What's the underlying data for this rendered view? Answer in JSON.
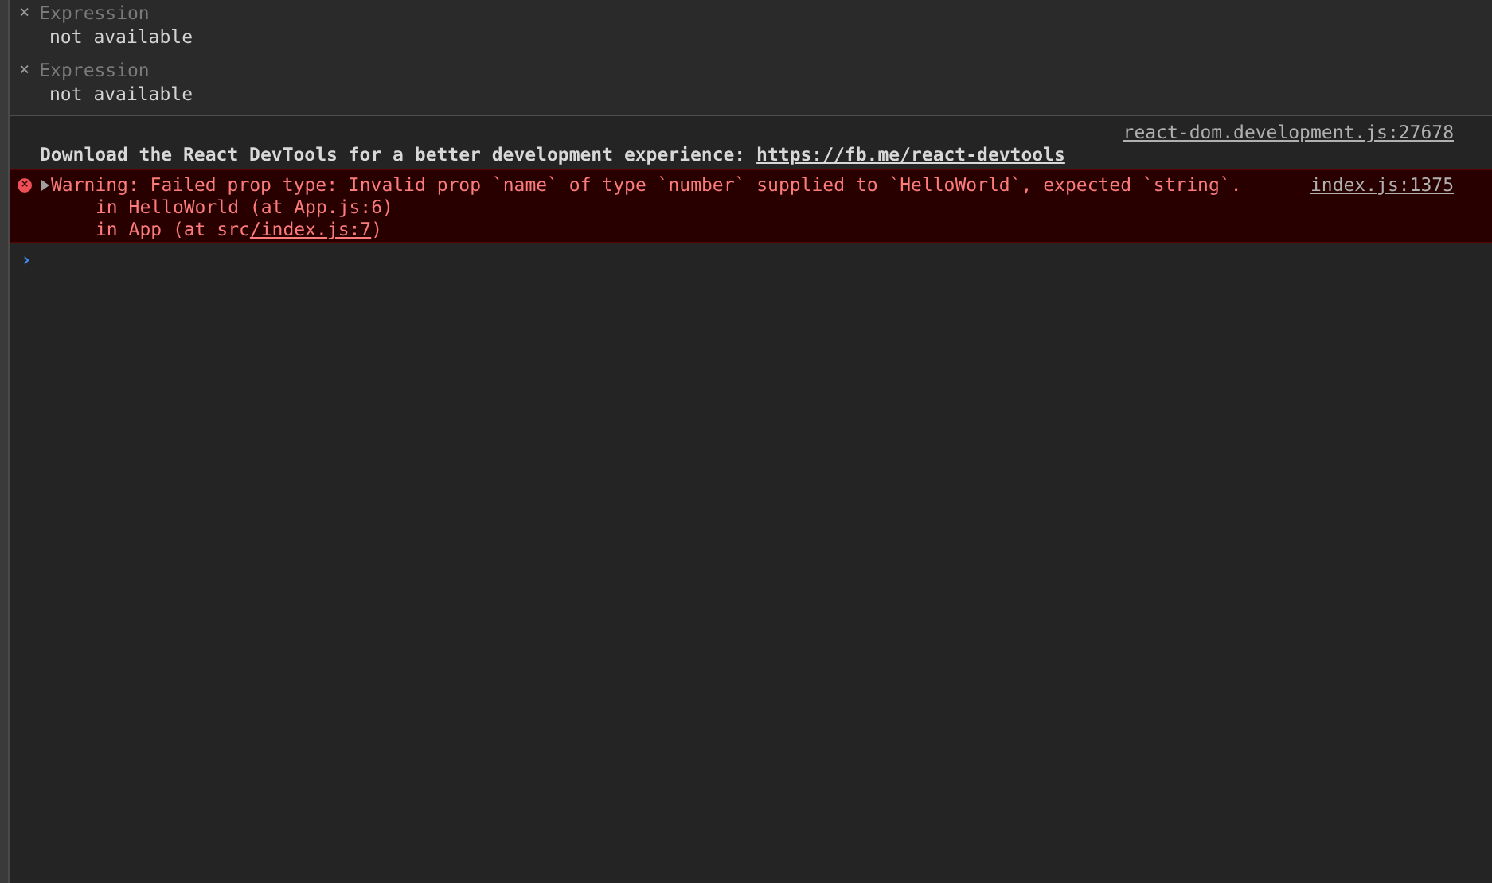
{
  "watch_expressions": [
    {
      "remove_icon": "×",
      "expression": "Expression",
      "value": "not available"
    },
    {
      "remove_icon": "×",
      "expression": "Expression",
      "value": "not available"
    }
  ],
  "console": {
    "messages": [
      {
        "kind": "info",
        "source": "react-dom.development.js:27678",
        "text": "Download the React DevTools for a better development experience: ",
        "link": "https://fb.me/react-devtools"
      },
      {
        "kind": "error",
        "icon": "×",
        "expanded": false,
        "text": "Warning: Failed prop type: Invalid prop `name` of type `number` supplied to `HelloWorld`, expected `string`.",
        "source": "index.js:1375",
        "stack": [
          {
            "text": "in HelloWorld (at App.js:6)"
          },
          {
            "text": "in App (at src",
            "link": "/index.js:7",
            "suffix": ")"
          }
        ]
      }
    ],
    "prompt": "›"
  }
}
